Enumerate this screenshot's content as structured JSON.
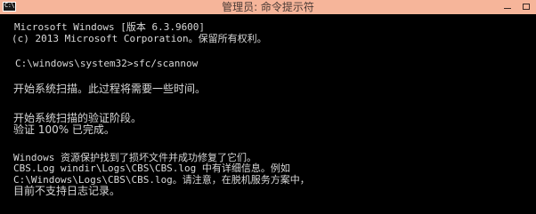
{
  "window": {
    "title": "管理员: 命令提示符",
    "icon_text": "C:\\",
    "controls": [
      "minimize-icon",
      "maximize-icon"
    ]
  },
  "colors": {
    "titlebar": "#f6b59a",
    "background": "#000000",
    "text": "#d8d8d8"
  },
  "console": {
    "lines": [
      "Microsoft Windows [版本 6.3.9600]",
      "(c) 2013 Microsoft Corporation。保留所有权利。",
      "C:\\windows\\system32>sfc/scannow",
      "开始系统扫描。此过程将需要一些时间。",
      "开始系统扫描的验证阶段。",
      "验证 100% 已完成。",
      "Windows 资源保护找到了损坏文件并成功修复了它们。",
      "CBS.Log windir\\Logs\\CBS\\CBS.log 中有详细信息。例如",
      "C:\\Windows\\Logs\\CBS\\CBS.log。请注意，在脱机服务方案中，",
      "目前不支持日志记录。"
    ]
  }
}
